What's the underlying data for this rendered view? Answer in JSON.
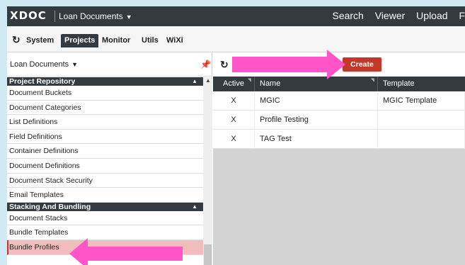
{
  "topbar": {
    "logo": "XDOC",
    "project_selector": "Loan Documents",
    "nav": [
      "Search",
      "Viewer",
      "Upload",
      "F"
    ]
  },
  "modules": [
    "System",
    "Projects",
    "Monitor",
    "Utils",
    "WiXi"
  ],
  "active_module": "Projects",
  "left_panel": {
    "project_dropdown": "Loan Documents",
    "sections": [
      {
        "title": "Project Repository",
        "items": [
          "Document Buckets",
          "Document Categories",
          "List Definitions",
          "Field Definitions",
          "Container Definitions",
          "Document Definitions",
          "Document Stack Security",
          "Email Templates"
        ]
      },
      {
        "title": "Stacking And Bundling",
        "items": [
          "Document Stacks",
          "Bundle Templates",
          "Bundle Profiles"
        ]
      }
    ],
    "selected_item": "Bundle Profiles"
  },
  "right_panel": {
    "create_label": "Create",
    "columns": [
      "Active",
      "Name",
      "Template"
    ],
    "rows": [
      {
        "active": "X",
        "name": "MGIC",
        "template": "MGIC Template"
      },
      {
        "active": "X",
        "name": "Profile Testing",
        "template": ""
      },
      {
        "active": "X",
        "name": "TAG Test",
        "template": ""
      }
    ]
  },
  "colors": {
    "header_dark": "#333a40",
    "accent_red": "#c0392b",
    "selected_bg": "#f2bcbc",
    "annotation_pink": "#ff55c8",
    "outer_bg": "#cfeaf3"
  },
  "icons": [
    "refresh-icon",
    "pin-icon",
    "caret-down-icon",
    "collapse-up-icon",
    "filter-icon"
  ]
}
